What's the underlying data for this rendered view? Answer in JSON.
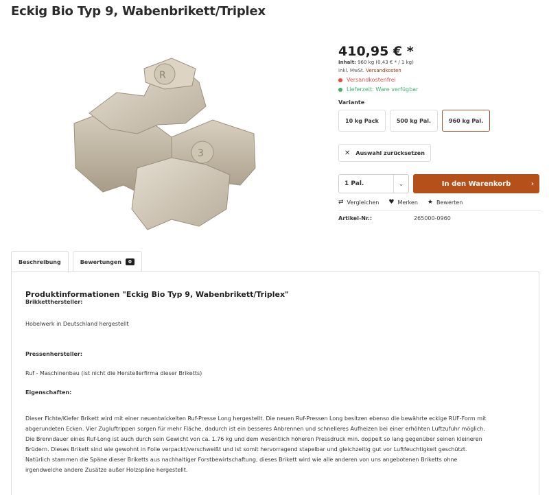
{
  "product": {
    "title": "Eckig Bio Typ 9, Wabenbrikett/Triplex",
    "image_alt": "briquette-stack-image"
  },
  "buybox": {
    "price": "410,95 € *",
    "inhalt_label": "Inhalt:",
    "inhalt_value": "960 kg (0,43 € * / 1 kg)",
    "tax_prefix": "inkl. MwSt.",
    "tax_link": "Versandkosten",
    "shipping_free": "Versandkostenfrei",
    "delivery": "Lieferzeit: Ware verfügbar",
    "variant_label": "Variante",
    "variants": [
      {
        "label": "10 kg Pack"
      },
      {
        "label": "500 kg Pal."
      },
      {
        "label": "960 kg Pal."
      }
    ],
    "reset_label": "Auswahl zurücksetzen",
    "quantity": "1 Pal.",
    "cart_label": "In den Warenkorb",
    "compare_label": "Vergleichen",
    "wishlist_label": "Merken",
    "review_label": "Bewerten",
    "artikel_label": "Artikel-Nr.:",
    "artikel_value": "265000-0960"
  },
  "tabs": {
    "description": "Beschreibung",
    "reviews": "Bewertungen",
    "reviews_count": "0"
  },
  "description": {
    "heading": "Produktinformationen \"Eckig Bio Typ 9, Wabenbrikett/Triplex\"",
    "maker_label": "Brikketthersteller:",
    "maker_value": "Hobelwerk in Deutschland hergestellt",
    "press_label": "Pressenhersteller:",
    "press_value": "Ruf - Maschinenbau (ist nicht die Herstellerfirma dieser Briketts)",
    "props_label": "Eigenschaften:",
    "props_lines": [
      "Dieser Fichte/Kiefer Brikett wird mit einer neuentwickelten Ruf-Presse Long hergestellt. Die neuen Ruf-Pressen Long besitzen ebenso die bewährte eckige RUF-Form mit",
      "abgerundeten Ecken. Vier Zugluftrippen sorgen für mehr Fläche, dadurch ist ein besseres Anbrennen und schnelleres Aufheizen bei einer erhöhten Luftzufuhr möglich.",
      "Die Brenndauer eines Ruf-Long ist auch durch sein Gewicht von ca. 1.76 kg und dem wesentlich höheren Pressdruck min. doppelt so lang gegenüber seinen kleineren",
      "Brüdern. Dieses Brikett sind wie gewohnt in Folie verpackt/verschweißt und ist somit hervorragend stapelbar und gleichzeitig gut vor Luftfeuchtigkeit geschützt.",
      "Natürlich stammen die Späne dieser Briketts aus nachhaltiger Forstbewirtschaftung, dieses Brikett wird wie alle anderen von uns angebotenen Briketts ohne",
      "irgendwelche andere Zusätze außer Holzspäne hergestellt."
    ]
  },
  "colors": {
    "accent": "#b5501a",
    "status_red": "#e74c3c",
    "status_green": "#3cb371"
  }
}
